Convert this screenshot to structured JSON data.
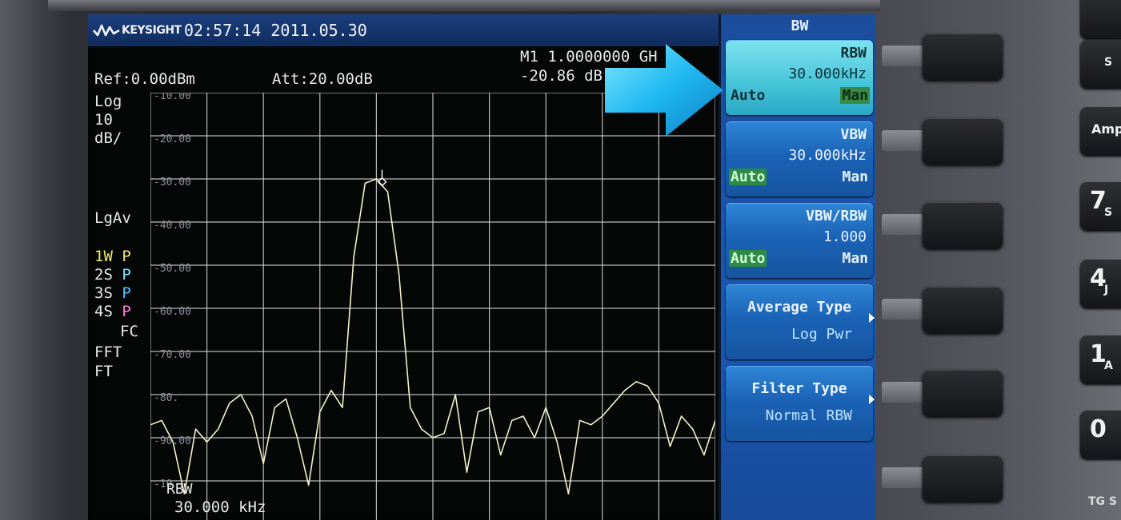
{
  "header": {
    "brand": "KEYSIGHT",
    "timestamp": "02:57:14 2011.05.30"
  },
  "measurement": {
    "ref": "Ref:0.00dBm",
    "att": "Att:20.00dB",
    "marker_freq": "M1 1.0000000 GH",
    "marker_amp": "-20.86 dB"
  },
  "left_panel": {
    "scale_lines": [
      "Log",
      "10",
      "dB/"
    ],
    "avg_type": "LgAv",
    "traces": [
      {
        "label": "1W",
        "mode": "P",
        "color": "#f3e96c"
      },
      {
        "label": "2S",
        "mode": "P",
        "color": "#7fe3ff"
      },
      {
        "label": "3S",
        "mode": "P",
        "color": "#4fc3ff"
      },
      {
        "label": "4S",
        "mode": "P",
        "color": "#ff7fd1"
      }
    ],
    "fc": "FC",
    "fft_lines": [
      "FFT",
      "FT"
    ]
  },
  "y_axis_labels": [
    "-10.00",
    "-20.00",
    "-30.00",
    "-40.00",
    "-50.00",
    "-60.00",
    "-70.00",
    "-80.",
    "-90.00",
    "-10"
  ],
  "footer": {
    "rbw_label": "RBW",
    "rbw_value": "30.000 kHz"
  },
  "softkeys": {
    "title": "BW",
    "items": [
      {
        "title": "RBW",
        "value": "30.000kHz",
        "auto": "Auto",
        "man": "Man",
        "selected": "man",
        "active": true
      },
      {
        "title": "VBW",
        "value": "30.000kHz",
        "auto": "Auto",
        "man": "Man",
        "selected": "auto",
        "active": false
      },
      {
        "title": "VBW/RBW",
        "value": "1.000",
        "auto": "Auto",
        "man": "Man",
        "selected": "auto",
        "active": false
      },
      {
        "title": "Average Type",
        "value": "Log Pwr",
        "submenu": true
      },
      {
        "title": "Filter Type",
        "value": "Normal RBW",
        "submenu": true
      }
    ]
  },
  "hardware_keys": [
    {
      "big": "",
      "small": "S"
    },
    {
      "big": "",
      "small": "Amp"
    },
    {
      "big": "7",
      "small": "S"
    },
    {
      "big": "4",
      "small": "J"
    },
    {
      "big": "1",
      "small": "A"
    },
    {
      "big": "0",
      "small": ""
    }
  ],
  "bottom_corner": "TG S",
  "colors": {
    "trace": "#f3f0c8",
    "grid": "#d9d9d9",
    "softkey_active": "#45c4d8",
    "softkey": "#1b63b7",
    "arrow": "#1fb8f0"
  },
  "chart_data": {
    "type": "line",
    "ylim": [
      -100,
      0
    ],
    "x": [
      0,
      2,
      4,
      6,
      8,
      10,
      12,
      14,
      16,
      18,
      20,
      22,
      24,
      26,
      28,
      30,
      32,
      34,
      36,
      38,
      40,
      42,
      44,
      46,
      48,
      50,
      52,
      54,
      56,
      58,
      60,
      62,
      64,
      66,
      68,
      70,
      72,
      74,
      76,
      78,
      80,
      82,
      84,
      86,
      88,
      90,
      92,
      94,
      96,
      98,
      100
    ],
    "series": [
      {
        "values": [
          -77,
          -76,
          -81,
          -93,
          -78,
          -81,
          -78,
          -72,
          -70,
          -75,
          -86,
          -73,
          -71,
          -80,
          -91,
          -74,
          -69,
          -73,
          -38,
          -21,
          -20,
          -23,
          -42,
          -73,
          -78,
          -80,
          -79,
          -70,
          -88,
          -74,
          -73,
          -84,
          -76,
          -75,
          -80,
          -73,
          -81,
          -93,
          -76,
          -77,
          -75,
          -72,
          -69,
          -67,
          -68,
          -72,
          -82,
          -75,
          -78,
          -84,
          -76
        ]
      }
    ],
    "marker": {
      "x": 41,
      "y": -20.86
    }
  }
}
